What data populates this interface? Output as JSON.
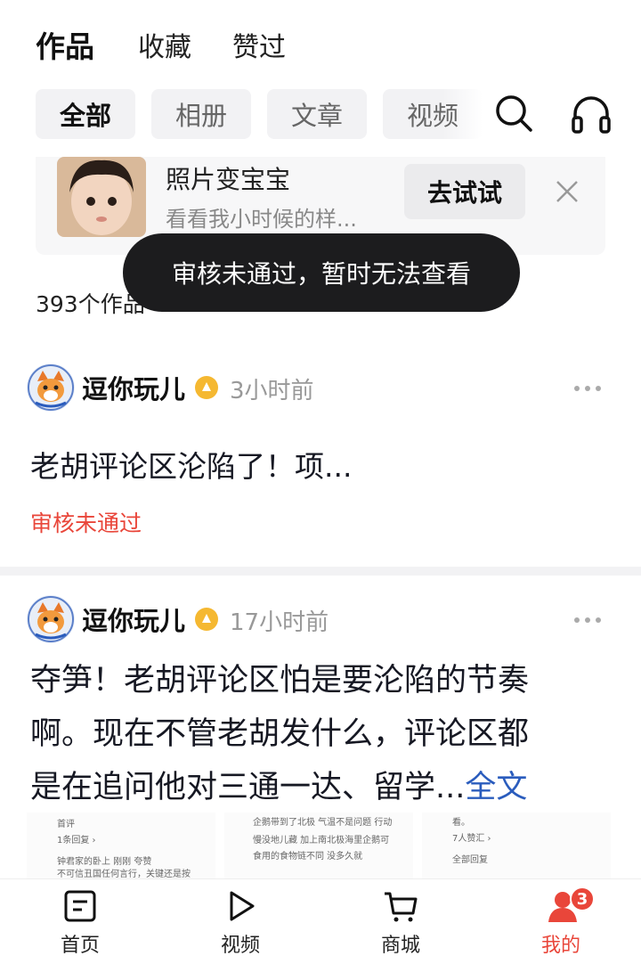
{
  "tabs": {
    "works": "作品",
    "favorites": "收藏",
    "liked": "赞过"
  },
  "filters": {
    "all": "全部",
    "album": "相册",
    "article": "文章",
    "video": "视频"
  },
  "promo": {
    "title": "照片变宝宝",
    "subtitle": "看看我小时候的样...",
    "button": "去试试"
  },
  "toast": "审核未通过，暂时无法查看",
  "works_count": "393个作品",
  "posts": [
    {
      "author": "逗你玩儿",
      "time": "3小时前",
      "text": "老胡评论区沦陷了！项...",
      "status": "审核未通过"
    },
    {
      "author": "逗你玩儿",
      "time": "17小时前",
      "lines": [
        "夺笋！老胡评论区怕是要沦陷的节奏",
        "啊。现在不管老胡发什么，评论区都",
        "是在追问他对三通一达、留学..."
      ],
      "more": "全文",
      "thumbs": [
        {
          "lines": [
            "首评",
            "1条回复 ›",
            "钟君家的卧上  刚刚  夸赞",
            "不可信丑国任何言行，关键还是按"
          ]
        },
        {
          "lines": [
            "企鹅带到了北极 气温不是问题 行动",
            "慢没地儿藏 加上南北极海里企鹅可",
            "食用的食物链不同 没多久就"
          ]
        },
        {
          "lines": [
            "看。",
            "7人赞汇 ›",
            "全部回复"
          ]
        }
      ]
    }
  ],
  "bottom_nav": [
    {
      "label": "首页",
      "icon": "home-icon"
    },
    {
      "label": "视频",
      "icon": "play-icon"
    },
    {
      "label": "商城",
      "icon": "cart-icon"
    },
    {
      "label": "我的",
      "icon": "profile-icon",
      "badge": "3"
    }
  ],
  "colors": {
    "accent_red": "#e9463a",
    "link_blue": "#2a5cbd",
    "toast_bg": "#1c1c1e"
  }
}
